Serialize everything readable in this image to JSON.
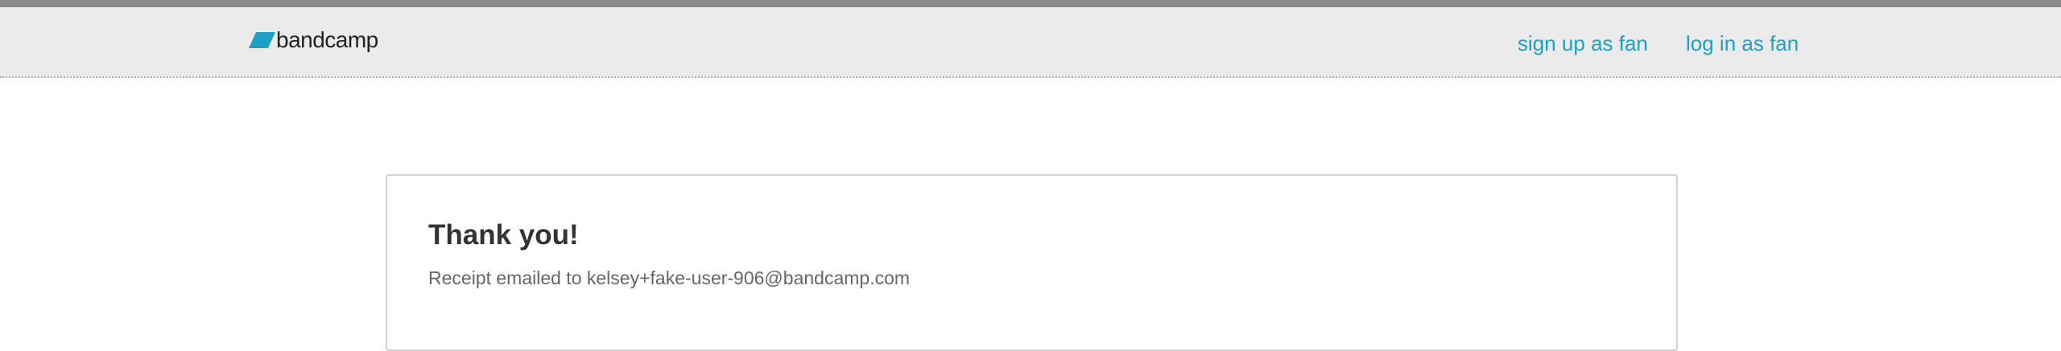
{
  "header": {
    "logo_text": "bandcamp",
    "logo_icon": "bandcamp-parallelogram-icon",
    "nav": {
      "sign_up": "sign up as fan",
      "log_in": "log in as fan"
    }
  },
  "confirmation": {
    "title": "Thank you!",
    "receipt_prefix": "Receipt emailed to",
    "email": "kelsey+fake-user-906@bandcamp.com"
  },
  "colors": {
    "accent": "#1da0c3",
    "header_background": "#ebebeb",
    "top_stripe": "#8a8a8a",
    "title_text": "#333333",
    "secondary_text": "#666666"
  }
}
